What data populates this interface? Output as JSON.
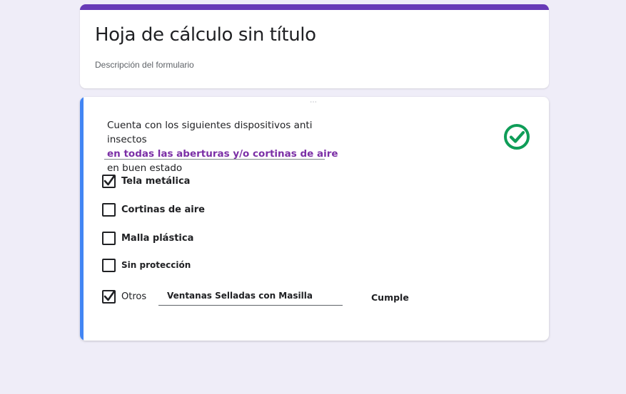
{
  "form": {
    "title": "Hoja de cálculo sin título",
    "description": "Descripción del formulario"
  },
  "colors": {
    "header_accent": "#673ab7",
    "question_accent": "#4285f4",
    "highlight": "#7b2fa6",
    "check_green": "#0f9d58"
  },
  "question": {
    "text_part1": "Cuenta con los siguientes dispositivos anti insectos",
    "text_highlight": "en  todas las aberturas y/o cortinas de aire",
    "text_part2": " en buen estado",
    "validated_icon": "check-circle-icon",
    "options": [
      {
        "label": "Tela metálica",
        "checked": true
      },
      {
        "label": "Cortinas de aire",
        "checked": false
      },
      {
        "label": "Malla plástica",
        "checked": false
      },
      {
        "label": "Sin protección",
        "checked": false
      },
      {
        "label": "Otros",
        "checked": true
      }
    ],
    "other_value": "Ventanas Selladas con Masilla",
    "status": "Cumple"
  }
}
